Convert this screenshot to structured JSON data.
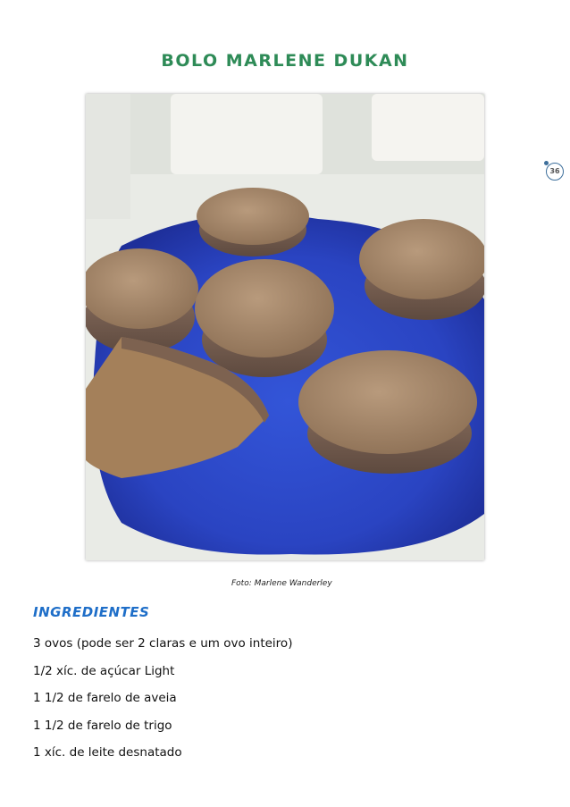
{
  "document": {
    "title": "BOLO MARLENE DUKAN",
    "page_number": "36",
    "photo_caption": "Foto: Marlene Wanderley",
    "section_title": "INGREDIENTES",
    "ingredients": [
      "3 ovos (pode ser 2 claras e um ovo inteiro)",
      "1/2 xíc. de açúcar Light",
      "1 1/2 de farelo de aveia",
      "1 1/2 de farelo de trigo",
      "1 xíc. de leite desnatado"
    ]
  },
  "colors": {
    "title": "#2e8b57",
    "section_title": "#1e6ec8",
    "plate": "#2b45c4",
    "muffin": "#a88a6c"
  }
}
